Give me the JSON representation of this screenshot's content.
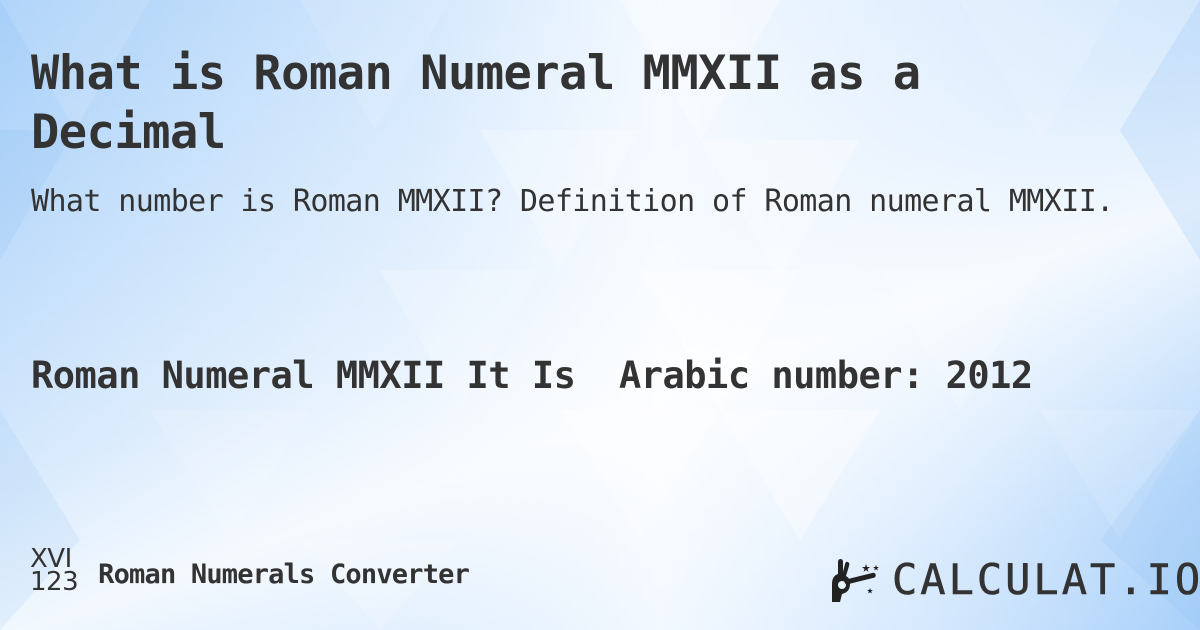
{
  "page": {
    "title": "What is Roman Numeral MMXII as a Decimal",
    "subtitle": "What number is Roman MMXII? Definition of Roman numeral MMXII.",
    "answer": "Roman Numeral MMXII It Is  Arabic number: 2012"
  },
  "footer": {
    "icon_top": "XVI",
    "icon_bottom": "123",
    "label": "Roman Numerals Converter"
  },
  "logo": {
    "icon": "magic-hand-icon",
    "text": "CALCULAT.IO"
  },
  "colors": {
    "text": "#333333",
    "background_blue": "#a6cff9",
    "background_light": "#eef6ff"
  }
}
